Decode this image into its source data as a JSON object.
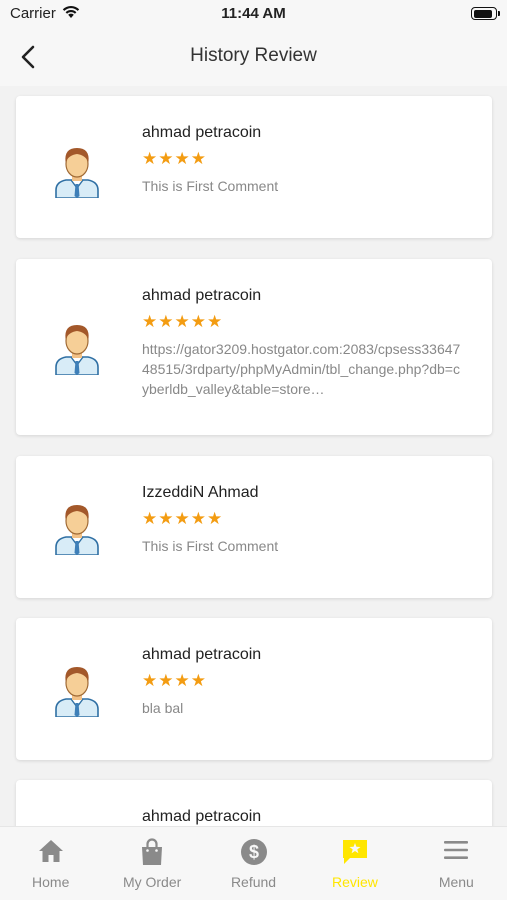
{
  "status": {
    "carrier": "Carrier",
    "time": "11:44 AM",
    "battery_level": 0.9
  },
  "header": {
    "title": "History Review"
  },
  "reviews": [
    {
      "name": "ahmad petracoin",
      "rating": 4,
      "stars": "★★★★",
      "comment": "This is First Comment"
    },
    {
      "name": "ahmad petracoin",
      "rating": 5,
      "stars": "★★★★★",
      "comment": "https://gator3209.hostgator.com:2083/cpsess3364748515/3rdparty/phpMyAdmin/tbl_change.php?db=cyberldb_valley&table=store…"
    },
    {
      "name": "IzzeddiN Ahmad",
      "rating": 5,
      "stars": "★★★★★",
      "comment": "This is First Comment"
    },
    {
      "name": "ahmad petracoin",
      "rating": 4,
      "stars": "★★★★",
      "comment": "bla bal"
    },
    {
      "name": "ahmad petracoin",
      "rating": null,
      "stars": "",
      "comment": ""
    }
  ],
  "tabs": [
    {
      "label": "Home",
      "icon": "home-icon"
    },
    {
      "label": "My Order",
      "icon": "shopping-bag-icon"
    },
    {
      "label": "Refund",
      "icon": "dollar-circle-icon"
    },
    {
      "label": "Review",
      "icon": "review-chat-icon",
      "active": true
    },
    {
      "label": "Menu",
      "icon": "hamburger-menu-icon"
    }
  ],
  "colors": {
    "star": "#f39c12",
    "active_tab": "#ffe600",
    "inactive_tab": "#8a8a8a"
  }
}
